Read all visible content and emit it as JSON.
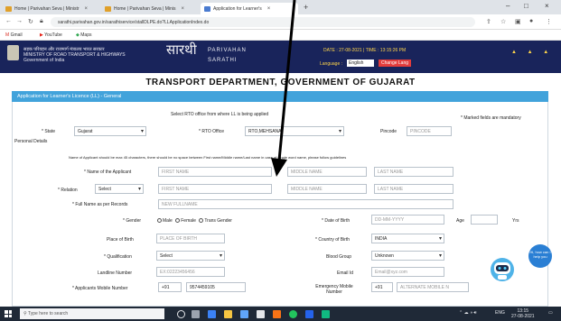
{
  "browser": {
    "tabs": [
      {
        "label": "Home | Parivahan Seva | Ministr",
        "active": false
      },
      {
        "label": "Home | Parivahan Seva | Minis",
        "active": false
      },
      {
        "label": "Application for Learner's",
        "active": true
      }
    ],
    "url": "sarathi.parivahan.gov.in/sarathiservice/stallDLPE.do?LLApplicationIndex.do",
    "bookmarks": [
      "Gmail",
      "YouTube",
      "Maps"
    ]
  },
  "site": {
    "ministry_hindi": "सड़क परिवहन और राजमार्ग मंत्रालय भारत सरकार",
    "ministry_line2": "MINISTRY OF ROAD TRANSPORT & HIGHWAYS",
    "ministry_line3": "Government of India",
    "logo_hindi": "सारथी",
    "logo_en1": "PARIVAHAN",
    "logo_en2": "SARATHI",
    "date_text": "DATE : 27-08-2021 | TIME : 13:15:26 PM",
    "language_label": "Language :",
    "language_value": "English",
    "change_language_button": "Change Lang",
    "header_icons": "▲ ▲ ▲"
  },
  "page": {
    "department_title": "TRANSPORT DEPARTMENT, GOVERNMENT OF GUJARAT",
    "section_title": "Application for Learner's Licence (LL) - General"
  },
  "form": {
    "rto_notice": "Select RTO office from where LL is being applied",
    "mandatory_note": "* Marked fields are mandatory",
    "state_label": "* State",
    "state_value": "Gujarat",
    "rto_label": "* RTO Office",
    "rto_value": "RTO,MEHSANA",
    "pincode_label": "Pincode",
    "pincode_placeholder": "PINCODE",
    "personal_details": "Personal Details",
    "name_note": "Name of Applicant should be max 45 characters, there should be no space between First name/Middle name/Last name in case of single word name, please follow guidelines",
    "applicant_name_label": "* Name of the Applicant",
    "first_name_ph": "FIRST NAME",
    "middle_name_ph": "MIDDLE NAME",
    "last_name_ph": "LAST NAME",
    "relation_label": "* Relation",
    "relation_value": "Select",
    "rel_first_ph": "FIRST NAME",
    "rel_middle_ph": "MIDDLE NAME",
    "rel_last_ph": "LAST NAME",
    "full_name_label": "* Full Name as per Records",
    "full_name_ph": "NEW FULLNAME",
    "gender_label": "* Gender",
    "gender_options": [
      "Male",
      "Female",
      "Trans Gender"
    ],
    "dob_label": "* Date of Birth",
    "dob_ph": "DD-MM-YYYY",
    "age_label": "Age",
    "yrs_label": "Yrs",
    "pob_label": "Place of Birth",
    "pob_ph": "PLACE OF BIRTH",
    "country_label": "* Country of Birth",
    "country_value": "INDIA",
    "qualification_label": "* Qualification",
    "qualification_value": "Select",
    "blood_label": "Blood Group",
    "blood_value": "Unknown",
    "landline_label": "Landline Number",
    "landline_ph": "EX:02223456456",
    "email_label": "Email Id",
    "email_ph": "Email@xyz.com",
    "mobile_label": "* Applicants Mobile Number",
    "mobile_code": "+91",
    "mobile_value": "9574459105",
    "emergency_label": "Emergency Mobile Number",
    "emergency_code": "+91",
    "emergency_ph": "ALTERNATE MOBILE N"
  },
  "taskbar": {
    "search_placeholder": "Type here to search",
    "time": "13:15",
    "date": "27-08-2021",
    "lang": "ENG"
  },
  "chatbot": {
    "bubble_text": "Hi, how can I help you"
  }
}
